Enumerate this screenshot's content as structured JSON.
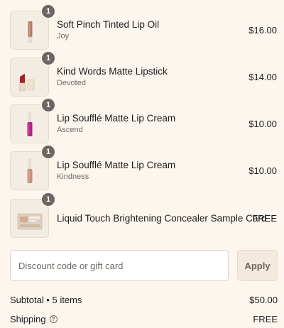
{
  "items": [
    {
      "quantity": "1",
      "name": "Soft Pinch Tinted Lip Oil",
      "variant": "Joy",
      "price": "$16.00",
      "image": "lip-oil-thumbnail"
    },
    {
      "quantity": "1",
      "name": "Kind Words Matte Lipstick",
      "variant": "Devoted",
      "price": "$14.00",
      "image": "lipstick-thumbnail"
    },
    {
      "quantity": "1",
      "name": "Lip Soufflé Matte Lip Cream",
      "variant": "Ascend",
      "price": "$10.00",
      "image": "lip-cream-magenta-thumbnail"
    },
    {
      "quantity": "1",
      "name": "Lip Soufflé Matte Lip Cream",
      "variant": "Kindness",
      "price": "$10.00",
      "image": "lip-cream-nude-thumbnail"
    },
    {
      "quantity": "1",
      "name": "Liquid Touch Brightening Concealer Sample Card",
      "variant": "",
      "price": "FREE",
      "image": "concealer-card-thumbnail"
    }
  ],
  "discount": {
    "placeholder": "Discount code or gift card",
    "apply_label": "Apply"
  },
  "totals": {
    "subtotal_label": "Subtotal • 5 items",
    "subtotal_value": "$50.00",
    "shipping_label": "Shipping",
    "shipping_value": "FREE"
  },
  "colors": {
    "background": "#fcf6ef",
    "badge": "#6b6661",
    "apply_button": "#f3e9dc"
  }
}
